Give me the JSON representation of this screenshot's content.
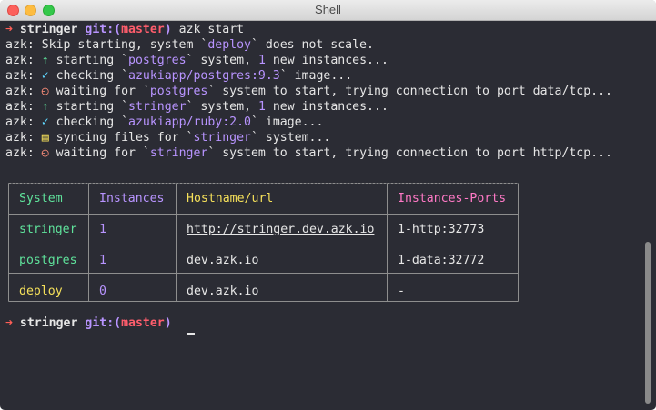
{
  "window": {
    "title": "Shell"
  },
  "prompt": {
    "arrow": "➜",
    "dir": "stringer",
    "git_label": "git:",
    "branch_open": "(",
    "branch": "master",
    "branch_close": ")",
    "command": "azk start"
  },
  "log": [
    {
      "prefix": "azk:",
      "text": " Skip starting, system `",
      "hl": "deploy",
      "tail": "` does not scale."
    },
    {
      "prefix": "azk:",
      "icon": "↑",
      "text": " starting `",
      "hl": "postgres",
      "tail": "` system, ",
      "num": "1",
      "tail2": " new instances..."
    },
    {
      "prefix": "azk:",
      "icon": "✓",
      "text": " checking `",
      "hl": "azukiapp/postgres:9.3",
      "tail": "` image..."
    },
    {
      "prefix": "azk:",
      "icon": "◴",
      "text": " waiting for `",
      "hl": "postgres",
      "tail": "` system to start, trying connection to port data/tcp..."
    },
    {
      "prefix": "azk:",
      "icon": "↑",
      "text": " starting `",
      "hl": "stringer",
      "tail": "` system, ",
      "num": "1",
      "tail2": " new instances..."
    },
    {
      "prefix": "azk:",
      "icon": "✓",
      "text": " checking `",
      "hl": "azukiapp/ruby:2.0",
      "tail": "` image..."
    },
    {
      "prefix": "azk:",
      "icon": "▤",
      "text": " syncing files for `",
      "hl": "stringer",
      "tail": "` system..."
    },
    {
      "prefix": "azk:",
      "icon": "◴",
      "text": " waiting for `",
      "hl": "stringer",
      "tail": "` system to start, trying connection to port http/tcp..."
    }
  ],
  "table": {
    "headers": [
      "System",
      "Instances",
      "Hostname/url",
      "Instances-Ports"
    ],
    "rows": [
      {
        "system": "stringer",
        "instances": "1",
        "hostname": "http://stringer.dev.azk.io",
        "ports": "1-http:32773"
      },
      {
        "system": "postgres",
        "instances": "1",
        "hostname": "dev.azk.io",
        "ports": "1-data:32772"
      },
      {
        "system": "deploy",
        "instances": "0",
        "hostname": "dev.azk.io",
        "ports": "-"
      }
    ]
  },
  "colors": {
    "background": "#2b2c34",
    "arrow": "#ff5f57",
    "git": "#b894ff",
    "branch": "#ff5d6c",
    "highlight": "#b894ff",
    "system_running": "#5fe29b",
    "system_idle": "#f5e05a",
    "header_system": "#5fe29b",
    "header_instances": "#b894ff",
    "header_hostname": "#f5e05a",
    "header_ports": "#ff79c6"
  }
}
